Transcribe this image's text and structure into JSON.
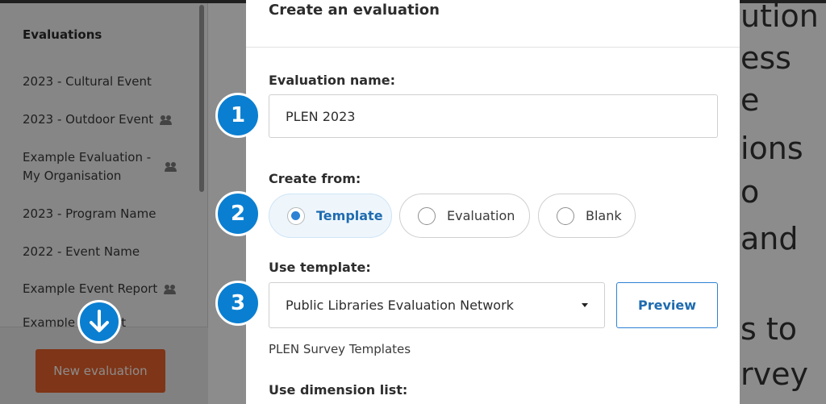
{
  "sidebar": {
    "title": "Evaluations",
    "items": [
      {
        "label": "2023 - Cultural Event",
        "shared": false
      },
      {
        "label": "2023 - Outdoor Event",
        "shared": true
      },
      {
        "label": "Example Evaluation - My Organisation",
        "shared": true
      },
      {
        "label": "2023 - Program Name",
        "shared": false
      },
      {
        "label": "2022 - Event Name",
        "shared": false
      },
      {
        "label": "Example Event Report",
        "shared": true
      },
      {
        "label": "Example ... ment",
        "shared": false
      }
    ],
    "new_button_label": "New evaluation"
  },
  "background_text": [
    "ution",
    "ess",
    "e",
    "ions",
    "o",
    "and",
    "s to",
    "rvey"
  ],
  "modal": {
    "title": "Create an evaluation",
    "name_label": "Evaluation name:",
    "name_value": "PLEN 2023",
    "create_from_label": "Create from:",
    "create_from_options": [
      {
        "label": "Template",
        "selected": true
      },
      {
        "label": "Evaluation",
        "selected": false
      },
      {
        "label": "Blank",
        "selected": false
      }
    ],
    "use_template_label": "Use template:",
    "template_selected": "Public Libraries Evaluation Network",
    "preview_label": "Preview",
    "template_helper": "PLEN Survey Templates",
    "dimension_label": "Use dimension list:"
  },
  "steps": [
    "1",
    "2",
    "3"
  ],
  "colors": {
    "accent": "#0a7fd1",
    "primary_button": "#e8612a",
    "link": "#1f6bb0"
  }
}
